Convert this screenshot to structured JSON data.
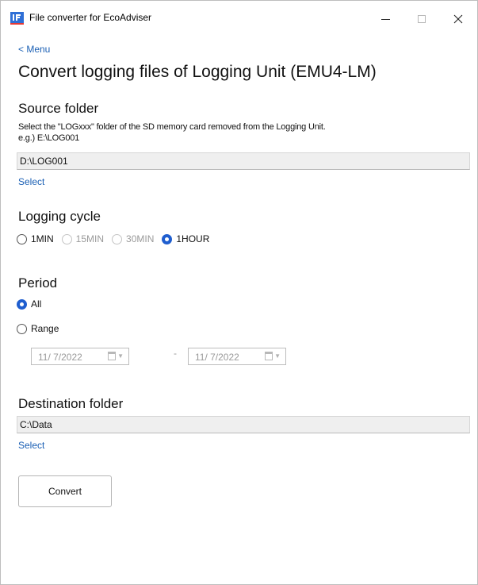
{
  "window": {
    "title": "File converter for EcoAdviser",
    "controls": {
      "minimize": "–",
      "maximize": "☐",
      "close": "✕"
    }
  },
  "nav": {
    "menu_label": "< Menu"
  },
  "page": {
    "title": "Convert logging files of Logging Unit (EMU4-LM)"
  },
  "source": {
    "title": "Source folder",
    "hint_line1": "Select the \"LOGxxx\" folder of the SD memory card removed from the Logging Unit.",
    "hint_line2": "e.g.) E:\\LOG001",
    "value": "D:\\LOG001",
    "select_label": "Select"
  },
  "logging_cycle": {
    "title": "Logging cycle",
    "options": [
      {
        "label": "1MIN",
        "checked": false,
        "enabled": true
      },
      {
        "label": "15MIN",
        "checked": false,
        "enabled": false
      },
      {
        "label": "30MIN",
        "checked": false,
        "enabled": false
      },
      {
        "label": "1HOUR",
        "checked": true,
        "enabled": true
      }
    ]
  },
  "period": {
    "title": "Period",
    "all_label": "All",
    "all_checked": true,
    "range_label": "Range",
    "range_checked": false,
    "from_date": "11/ 7/2022",
    "to_date": "11/ 7/2022",
    "separator": "-"
  },
  "destination": {
    "title": "Destination folder",
    "value": "C:\\Data",
    "select_label": "Select"
  },
  "actions": {
    "convert_label": "Convert"
  },
  "colors": {
    "accent": "#1f5ecf",
    "link": "#1a5fb4",
    "field_bg": "#efefef"
  }
}
